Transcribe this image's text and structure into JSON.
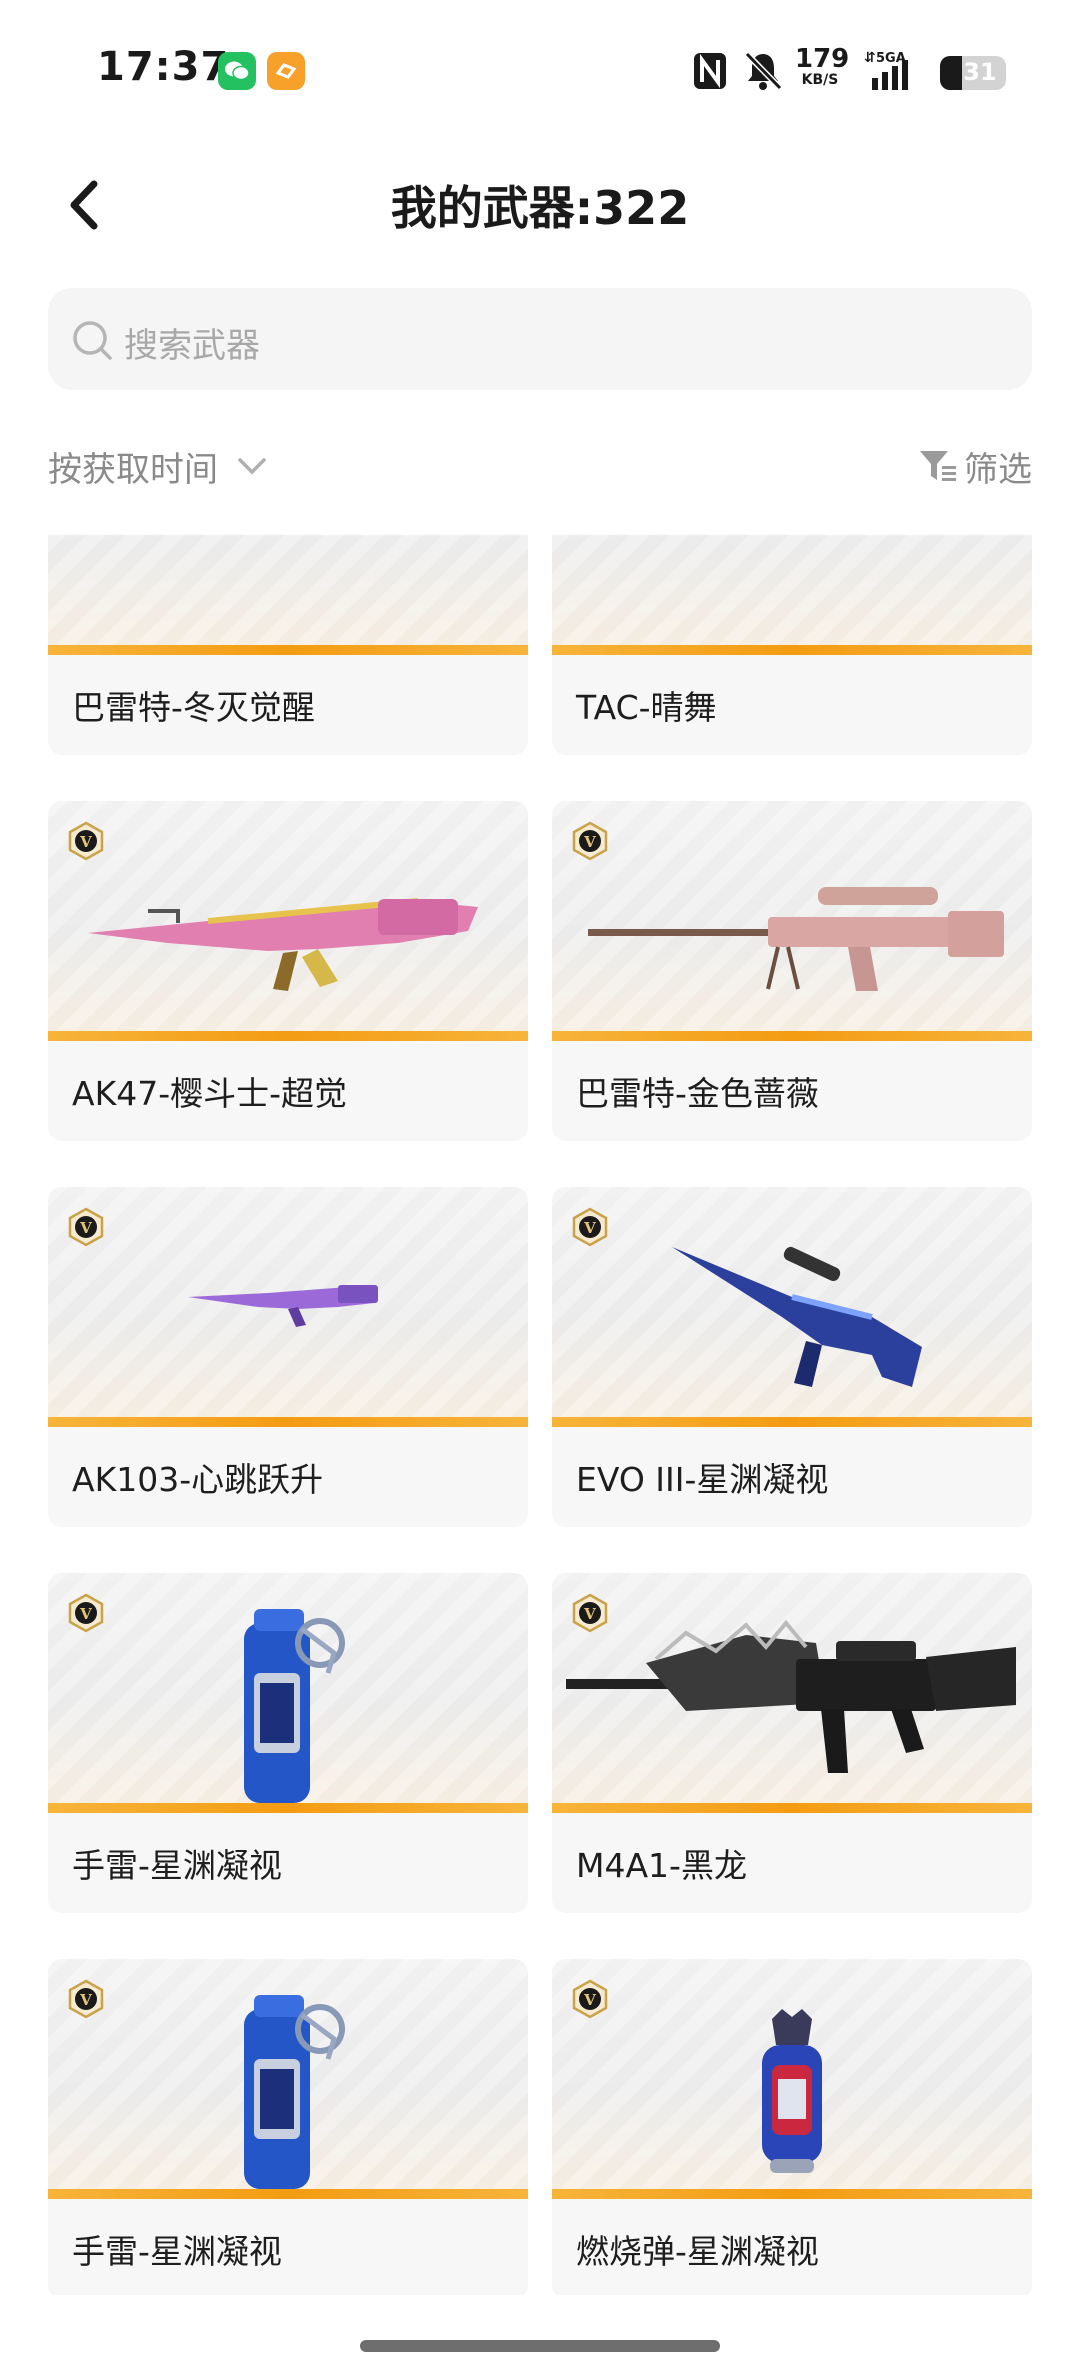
{
  "status_bar": {
    "time": "17:37",
    "speed_value": "179",
    "speed_unit": "KB/S",
    "network": "5GA",
    "battery": "31"
  },
  "header": {
    "title": "我的武器:322"
  },
  "search": {
    "placeholder": "搜索武器"
  },
  "toolbar": {
    "sort_label": "按获取时间",
    "filter_label": "筛选"
  },
  "weapons": [
    {
      "name": "巴雷特-冬灭觉醒",
      "badge": false,
      "art": "partial-pink"
    },
    {
      "name": "TAC-晴舞",
      "badge": false,
      "art": "partial-pink2"
    },
    {
      "name": "AK47-樱斗士-超觉",
      "badge": true,
      "art": "ak-pink-gold"
    },
    {
      "name": "巴雷特-金色蔷薇",
      "badge": true,
      "art": "sniper-rose"
    },
    {
      "name": "AK103-心跳跃升",
      "badge": true,
      "art": "ak-purple-small"
    },
    {
      "name": "EVO III-星渊凝视",
      "badge": true,
      "art": "smg-blue"
    },
    {
      "name": "手雷-星渊凝视",
      "badge": true,
      "art": "grenade-blue"
    },
    {
      "name": "M4A1-黑龙",
      "badge": true,
      "art": "m4-black"
    },
    {
      "name": "手雷-星渊凝视",
      "badge": true,
      "art": "grenade-blue"
    },
    {
      "name": "燃烧弹-星渊凝视",
      "badge": true,
      "art": "molotov-blue"
    }
  ],
  "colors": {
    "accent_bar": "#f39c12",
    "badge_gold": "#c9a24a",
    "card_bg": "#f7f7f7"
  }
}
